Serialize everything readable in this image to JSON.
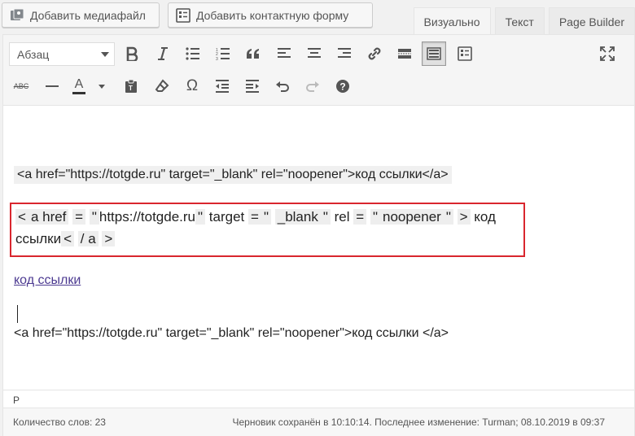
{
  "top_buttons": {
    "add_media": "Добавить медиафайл",
    "add_contact_form": "Добавить контактную форму"
  },
  "tabs": [
    {
      "label": "Визуально",
      "active": true
    },
    {
      "label": "Текст",
      "active": false
    },
    {
      "label": "Page Builder",
      "active": false
    }
  ],
  "toolbar": {
    "format_select": "Абзац",
    "strike_label": "ABC",
    "text_color_label": "A",
    "row1_icons": [
      "bold-icon",
      "italic-icon",
      "bullet-list-icon",
      "numbered-list-icon",
      "blockquote-icon",
      "align-left-icon",
      "align-center-icon",
      "align-right-icon",
      "link-icon",
      "read-more-icon",
      "toolbar-toggle-icon",
      "form-icon",
      "fullscreen-icon"
    ],
    "row2_icons": [
      "strikethrough-icon",
      "horizontal-line-icon",
      "text-color-icon",
      "paste-text-icon",
      "clear-format-icon",
      "special-char-icon",
      "outdent-icon",
      "indent-icon",
      "undo-icon",
      "redo-icon",
      "help-icon"
    ]
  },
  "content": {
    "code_line1": "<a href=\"https://totgde.ru\" target=\"_blank\" rel=\"noopener\">код ссылки</a>",
    "red_box_tokens": [
      "<",
      "a href",
      "=",
      "\"",
      "https://totgde.ru",
      "\"",
      "target",
      "=",
      "\"",
      "_blank",
      "\"",
      "rel",
      "=",
      "\"",
      "noopener",
      "\"",
      ">",
      "код ссылки",
      "<",
      "/ a",
      ">"
    ],
    "link_text": "код ссылки",
    "code_line2": "<a href=\"https://totgde.ru\" target=\"_blank\" rel=\"noopener\">код ссылки </a>"
  },
  "status": {
    "path": "P",
    "word_count": "Количество слов: 23",
    "draft": "Черновик сохранён в 10:10:14. Последнее изменение: Turman; 08.10.2019 в 09:37"
  },
  "colors": {
    "highlight_box": "#d9262e",
    "link": "#4c3a91"
  }
}
